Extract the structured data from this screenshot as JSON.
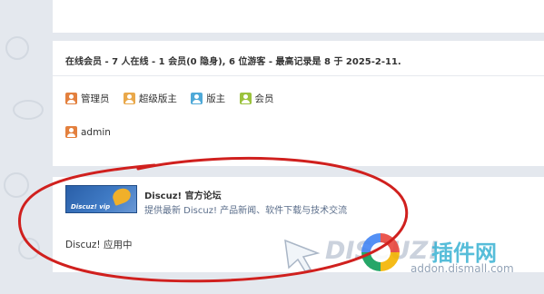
{
  "online": {
    "title": "在线会员 - 7 人在线 - 1 会员(0 隐身), 6 位游客 - 最高记录是 8 于 2025-2-11.",
    "legend": [
      {
        "label": "管理员",
        "icon": "admin-icon"
      },
      {
        "label": "超级版主",
        "icon": "super-moderator-icon"
      },
      {
        "label": "版主",
        "icon": "moderator-icon"
      },
      {
        "label": "会员",
        "icon": "member-icon"
      }
    ],
    "users": [
      {
        "name": "admin",
        "icon": "admin-icon"
      }
    ]
  },
  "links": {
    "forum": {
      "logo_text": "Discuz! vip",
      "name": "Discuz! 官方论坛",
      "description": "提供最新 Discuz! 产品新闻、软件下载与技术交流"
    },
    "text_link": "Discuz! 应用中"
  },
  "watermark": {
    "brand": "DISCUZ!",
    "cn": "插件网",
    "url": "addon.dismall.com"
  },
  "colors": {
    "background": "#e4e8ee",
    "panel": "#ffffff",
    "admin": "#e3803e",
    "super_moderator": "#e9a84a",
    "moderator": "#4fa9d8",
    "member": "#9bc23d",
    "annotation": "#d0201e"
  }
}
